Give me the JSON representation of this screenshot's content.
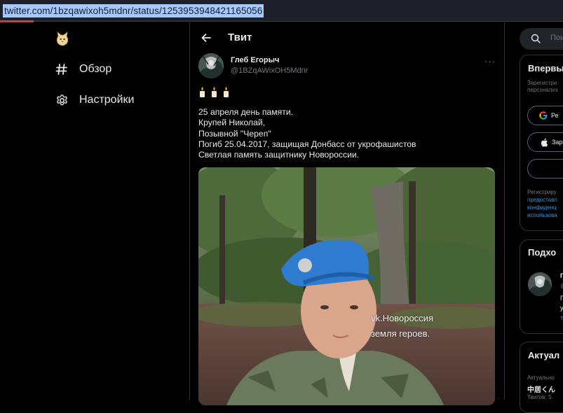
{
  "address_bar": {
    "url": "twitter.com/1bzqawixoh5mdnr/status/1253953948421165056"
  },
  "left_nav": {
    "items": [
      {
        "label": "Обзор",
        "icon": "hashtag-icon"
      },
      {
        "label": "Настройки",
        "icon": "gear-icon"
      }
    ]
  },
  "header": {
    "title": "Твит"
  },
  "tweet": {
    "author_name": "Глеб Егорыч",
    "author_handle": "@1BZqAWixOH5Mdnr",
    "more_label": "···",
    "lines": [
      "25 апреля день памяти.",
      "Крупей Николай,",
      "Позывной \"Череп\"",
      "Погиб 25.04.2017, защищая Донбасс от укрофашистов",
      "Светлая память защитнику Новороссии."
    ],
    "image_watermark": [
      "vk.Новороссия",
      "земля героев."
    ]
  },
  "sidebar": {
    "search_placeholder": "Пои",
    "signup": {
      "title": "Впервы",
      "intro_lines": [
        "Зарегистри",
        "персонализ"
      ],
      "google_label": "Ре",
      "apple_label": "Зар",
      "terms_lines": [
        "Регистриру",
        "предоставл",
        "конфиденц",
        "использова"
      ]
    },
    "follow": {
      "title": "Подхо",
      "name_fragment": "Г",
      "handle_fragment": "@",
      "text_fragments": [
        "Г",
        "у",
        "т"
      ]
    },
    "trends": {
      "title": "Актуал",
      "subtitle": "Актуально",
      "topic": "中居くん",
      "count_fragment": "Твитов: 5"
    }
  },
  "colors": {
    "accent": "#1d9bf0",
    "background": "#000000",
    "url_highlight": "#a8c7fa"
  }
}
